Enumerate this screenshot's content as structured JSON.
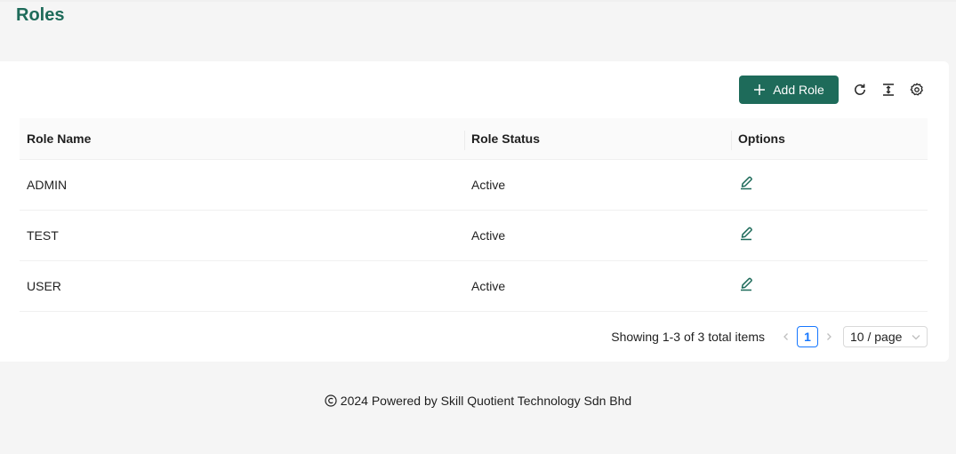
{
  "page": {
    "title": "Roles"
  },
  "toolbar": {
    "add_label": "Add Role",
    "icons": [
      "plus-icon",
      "reload-icon",
      "column-height-icon",
      "setting-icon"
    ]
  },
  "table": {
    "columns": [
      "Role Name",
      "Role Status",
      "Options"
    ],
    "rows": [
      {
        "name": "ADMIN",
        "status": "Active"
      },
      {
        "name": "TEST",
        "status": "Active"
      },
      {
        "name": "USER",
        "status": "Active"
      }
    ]
  },
  "pagination": {
    "total_text": "Showing 1-3 of 3 total items",
    "current_page": "1",
    "page_size": "10 / page"
  },
  "footer": {
    "text": "2024 Powered by Skill Quotient Technology Sdn Bhd"
  },
  "colors": {
    "brand": "#1e6b5a",
    "link": "#1677ff"
  }
}
